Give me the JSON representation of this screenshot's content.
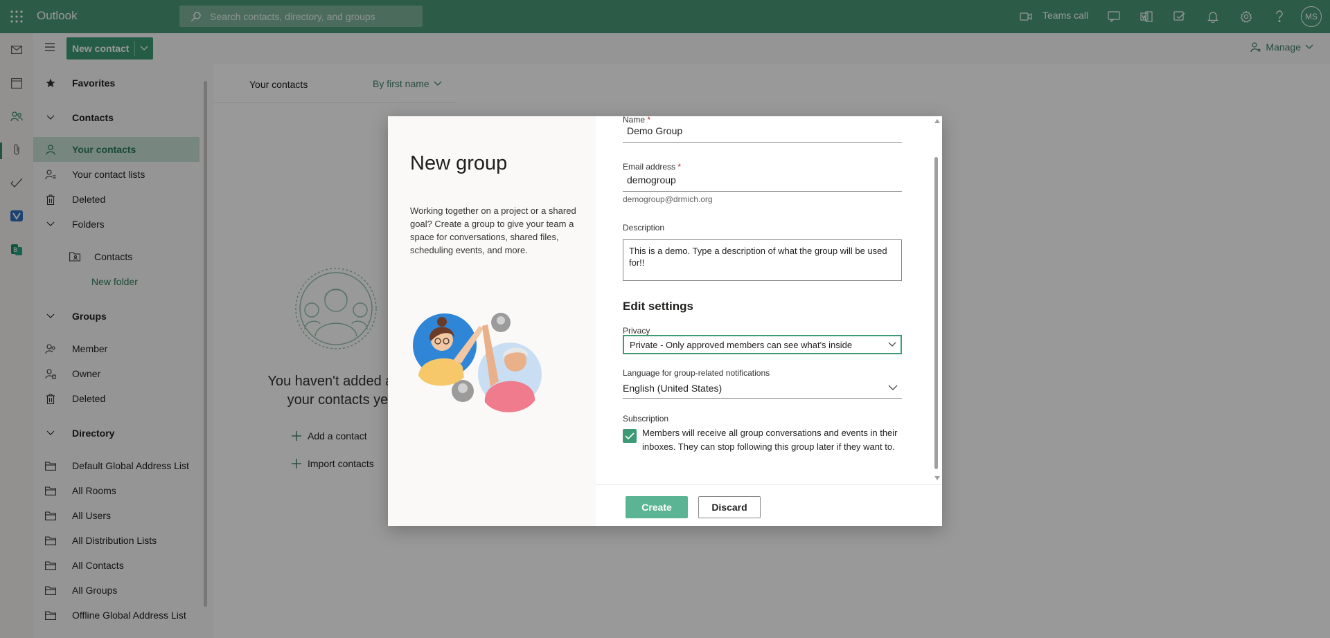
{
  "header": {
    "app_name": "Outlook",
    "search_placeholder": "Search contacts, directory, and groups",
    "teams_call_label": "Teams call",
    "avatar_initials": "MS"
  },
  "rail": {
    "icons": [
      "mail-icon",
      "calendar-icon",
      "people-icon",
      "files-icon",
      "todo-icon",
      "viva-icon",
      "bookings-icon"
    ],
    "active": "people-icon"
  },
  "commandbar": {
    "new_contact_label": "New contact",
    "manage_label": "Manage"
  },
  "folders": {
    "favorites": "Favorites",
    "contacts_header": "Contacts",
    "your_contacts": "Your contacts",
    "your_contact_lists": "Your contact lists",
    "deleted": "Deleted",
    "folders_header": "Folders",
    "contacts_folder": "Contacts",
    "new_folder": "New folder",
    "groups_header": "Groups",
    "member": "Member",
    "owner": "Owner",
    "groups_deleted": "Deleted",
    "directory_header": "Directory",
    "directory_items": [
      "Default Global Address List",
      "All Rooms",
      "All Users",
      "All Distribution Lists",
      "All Contacts",
      "All Groups",
      "Offline Global Address List"
    ]
  },
  "list": {
    "title": "Your contacts",
    "sort_label": "By first name",
    "empty_line1": "You haven't added anyo",
    "empty_line2": "your contacts yet.",
    "add_contact": "Add a contact",
    "import_contacts": "Import contacts"
  },
  "dialog": {
    "title": "New group",
    "intro": "Working together on a project or a shared goal? Create a group to give your team a space for conversations, shared files, scheduling events, and more.",
    "name_label": "Name",
    "name_value": "Demo Group",
    "email_label": "Email address",
    "required_mark": "*",
    "email_value": "demogroup",
    "email_helper": "demogroup@drmich.org",
    "description_label": "Description",
    "description_value": "This is a demo. Type a description of what the group will be used for!!",
    "edit_settings": "Edit settings",
    "privacy_label": "Privacy",
    "privacy_value": "Private - Only approved members can see what's inside",
    "language_label": "Language for group-related notifications",
    "language_value": "English (United States)",
    "subscription_label": "Subscription",
    "subscription_checked": true,
    "subscription_text": "Members will receive all group conversations and events in their inboxes. They can stop following this group later if they want to.",
    "create_label": "Create",
    "discard_label": "Discard"
  },
  "colors": {
    "brand": "#4a9a78",
    "accent": "#3d9a74",
    "selected_bg": "#c7e0d4"
  }
}
